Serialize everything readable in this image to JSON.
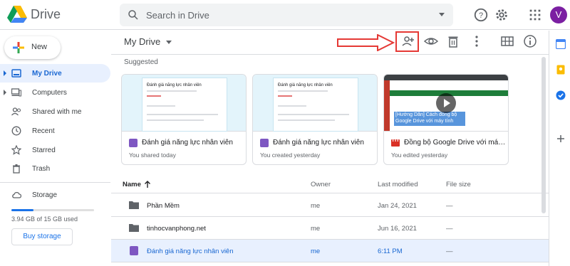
{
  "app": {
    "brand": "Drive"
  },
  "search": {
    "placeholder": "Search in Drive"
  },
  "user": {
    "avatar_letter": "V",
    "avatar_color": "#7b1fa2"
  },
  "sidebar": {
    "new_label": "New",
    "items": [
      {
        "label": "My Drive",
        "icon": "my-drive-icon",
        "active": true,
        "expandable": true
      },
      {
        "label": "Computers",
        "icon": "computer-icon",
        "active": false,
        "expandable": true
      },
      {
        "label": "Shared with me",
        "icon": "people-icon",
        "active": false,
        "expandable": false
      },
      {
        "label": "Recent",
        "icon": "clock-icon",
        "active": false,
        "expandable": false
      },
      {
        "label": "Starred",
        "icon": "star-icon",
        "active": false,
        "expandable": false
      },
      {
        "label": "Trash",
        "icon": "trash-icon",
        "active": false,
        "expandable": false
      }
    ],
    "storage": {
      "label": "Storage",
      "used_text": "3.94 GB of 15 GB used",
      "used_fraction": 0.263,
      "buy_label": "Buy storage"
    }
  },
  "main": {
    "title": "My Drive",
    "suggested_label": "Suggested",
    "cards": [
      {
        "name": "Đánh giá năng lực nhân viên",
        "meta": "You shared today",
        "type": "form",
        "thumb_title": "Đánh giá năng lực nhân viên"
      },
      {
        "name": "Đánh giá năng lực nhân viên",
        "meta": "You created yesterday",
        "type": "form",
        "thumb_title": "Đánh giá năng lực nhân viên"
      },
      {
        "name": "Đồng bộ Google Drive với máy tính",
        "meta": "You edited yesterday",
        "type": "video",
        "thumb_title": "[Hướng Dẫn] Cách đồng bộ Google Drive với máy tính"
      }
    ],
    "columns": {
      "name": "Name",
      "owner": "Owner",
      "modified": "Last modified",
      "size": "File size"
    },
    "files": [
      {
        "name": "Phần Mềm",
        "type": "folder",
        "owner": "me",
        "modified": "Jan 24, 2021",
        "size": "—",
        "selected": false
      },
      {
        "name": "tinhocvanphong.net",
        "type": "folder",
        "owner": "me",
        "modified": "Jun 16, 2021",
        "size": "—",
        "selected": false
      },
      {
        "name": "Đánh giá năng lực nhân viên",
        "type": "form",
        "owner": "me",
        "modified": "6:11 PM",
        "size": "—",
        "selected": true
      }
    ]
  },
  "colors": {
    "accent": "#1a73e8",
    "active_bg": "#e8f0fe",
    "annotation": "#e53935",
    "form_purple": "#7e57c2"
  }
}
